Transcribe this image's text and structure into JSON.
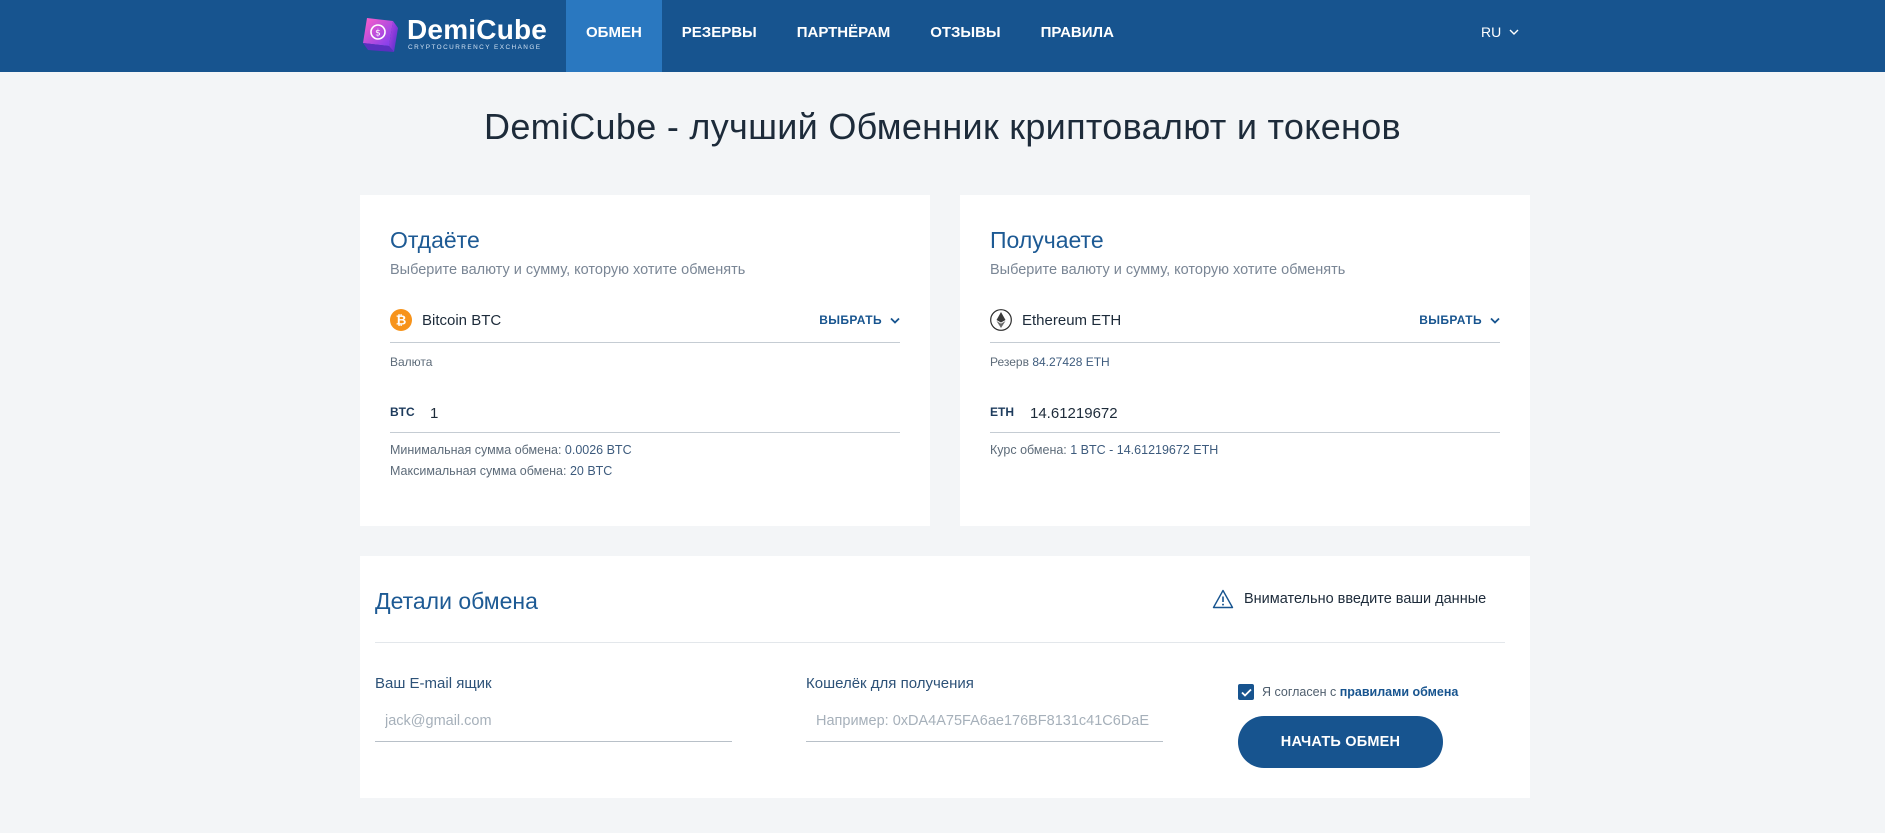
{
  "header": {
    "brand_name": "DemiCube",
    "brand_tagline": "CRYPTOCURRENCY EXCHANGE",
    "nav": [
      {
        "label": "ОБМЕН",
        "active": true
      },
      {
        "label": "РЕЗЕРВЫ",
        "active": false
      },
      {
        "label": "ПАРТНЁРАМ",
        "active": false
      },
      {
        "label": "ОТЗЫВЫ",
        "active": false
      },
      {
        "label": "ПРАВИЛА",
        "active": false
      }
    ],
    "language": "RU",
    "colors": {
      "bar": "#17548f",
      "active_tab": "#2a78c0"
    }
  },
  "page_title": "DemiCube - лучший Обменник криптовалют и токенов",
  "give": {
    "title": "Отдаёте",
    "subtitle": "Выберите валюту и сумму, которую хотите обменять",
    "currency_name": "Bitcoin BTC",
    "currency_icon": "bitcoin-icon",
    "select_label": "ВЫБРАТЬ",
    "caption": "Валюта",
    "amount_code": "BTC",
    "amount_value": "1",
    "min_label": "Минимальная сумма обмена: ",
    "min_value": "0.0026 BTC",
    "max_label": "Максимальная сумма обмена: ",
    "max_value": "20 BTC"
  },
  "get": {
    "title": "Получаете",
    "subtitle": "Выберите валюту и сумму, которую хотите обменять",
    "currency_name": "Ethereum ETH",
    "currency_icon": "ethereum-icon",
    "select_label": "ВЫБРАТЬ",
    "reserve_label": "Резерв ",
    "reserve_value": "84.27428 ETH",
    "amount_code": "ETH",
    "amount_value": "14.61219672",
    "rate_label": "Курс обмена: ",
    "rate_value": "1 BTC - 14.61219672 ETH"
  },
  "details": {
    "title": "Детали обмена",
    "warning": "Внимательно введите ваши данные",
    "email_label": "Ваш E-mail ящик",
    "email_placeholder": "jack@gmail.com",
    "wallet_label": "Кошелёк для получения",
    "wallet_placeholder": "Например: 0xDA4A75FA6ae176BF8131c41C6DaE",
    "agree_text": "Я согласен с ",
    "agree_link": "правилами обмена",
    "agree_checked": true,
    "start_button": "НАЧАТЬ ОБМЕН"
  }
}
